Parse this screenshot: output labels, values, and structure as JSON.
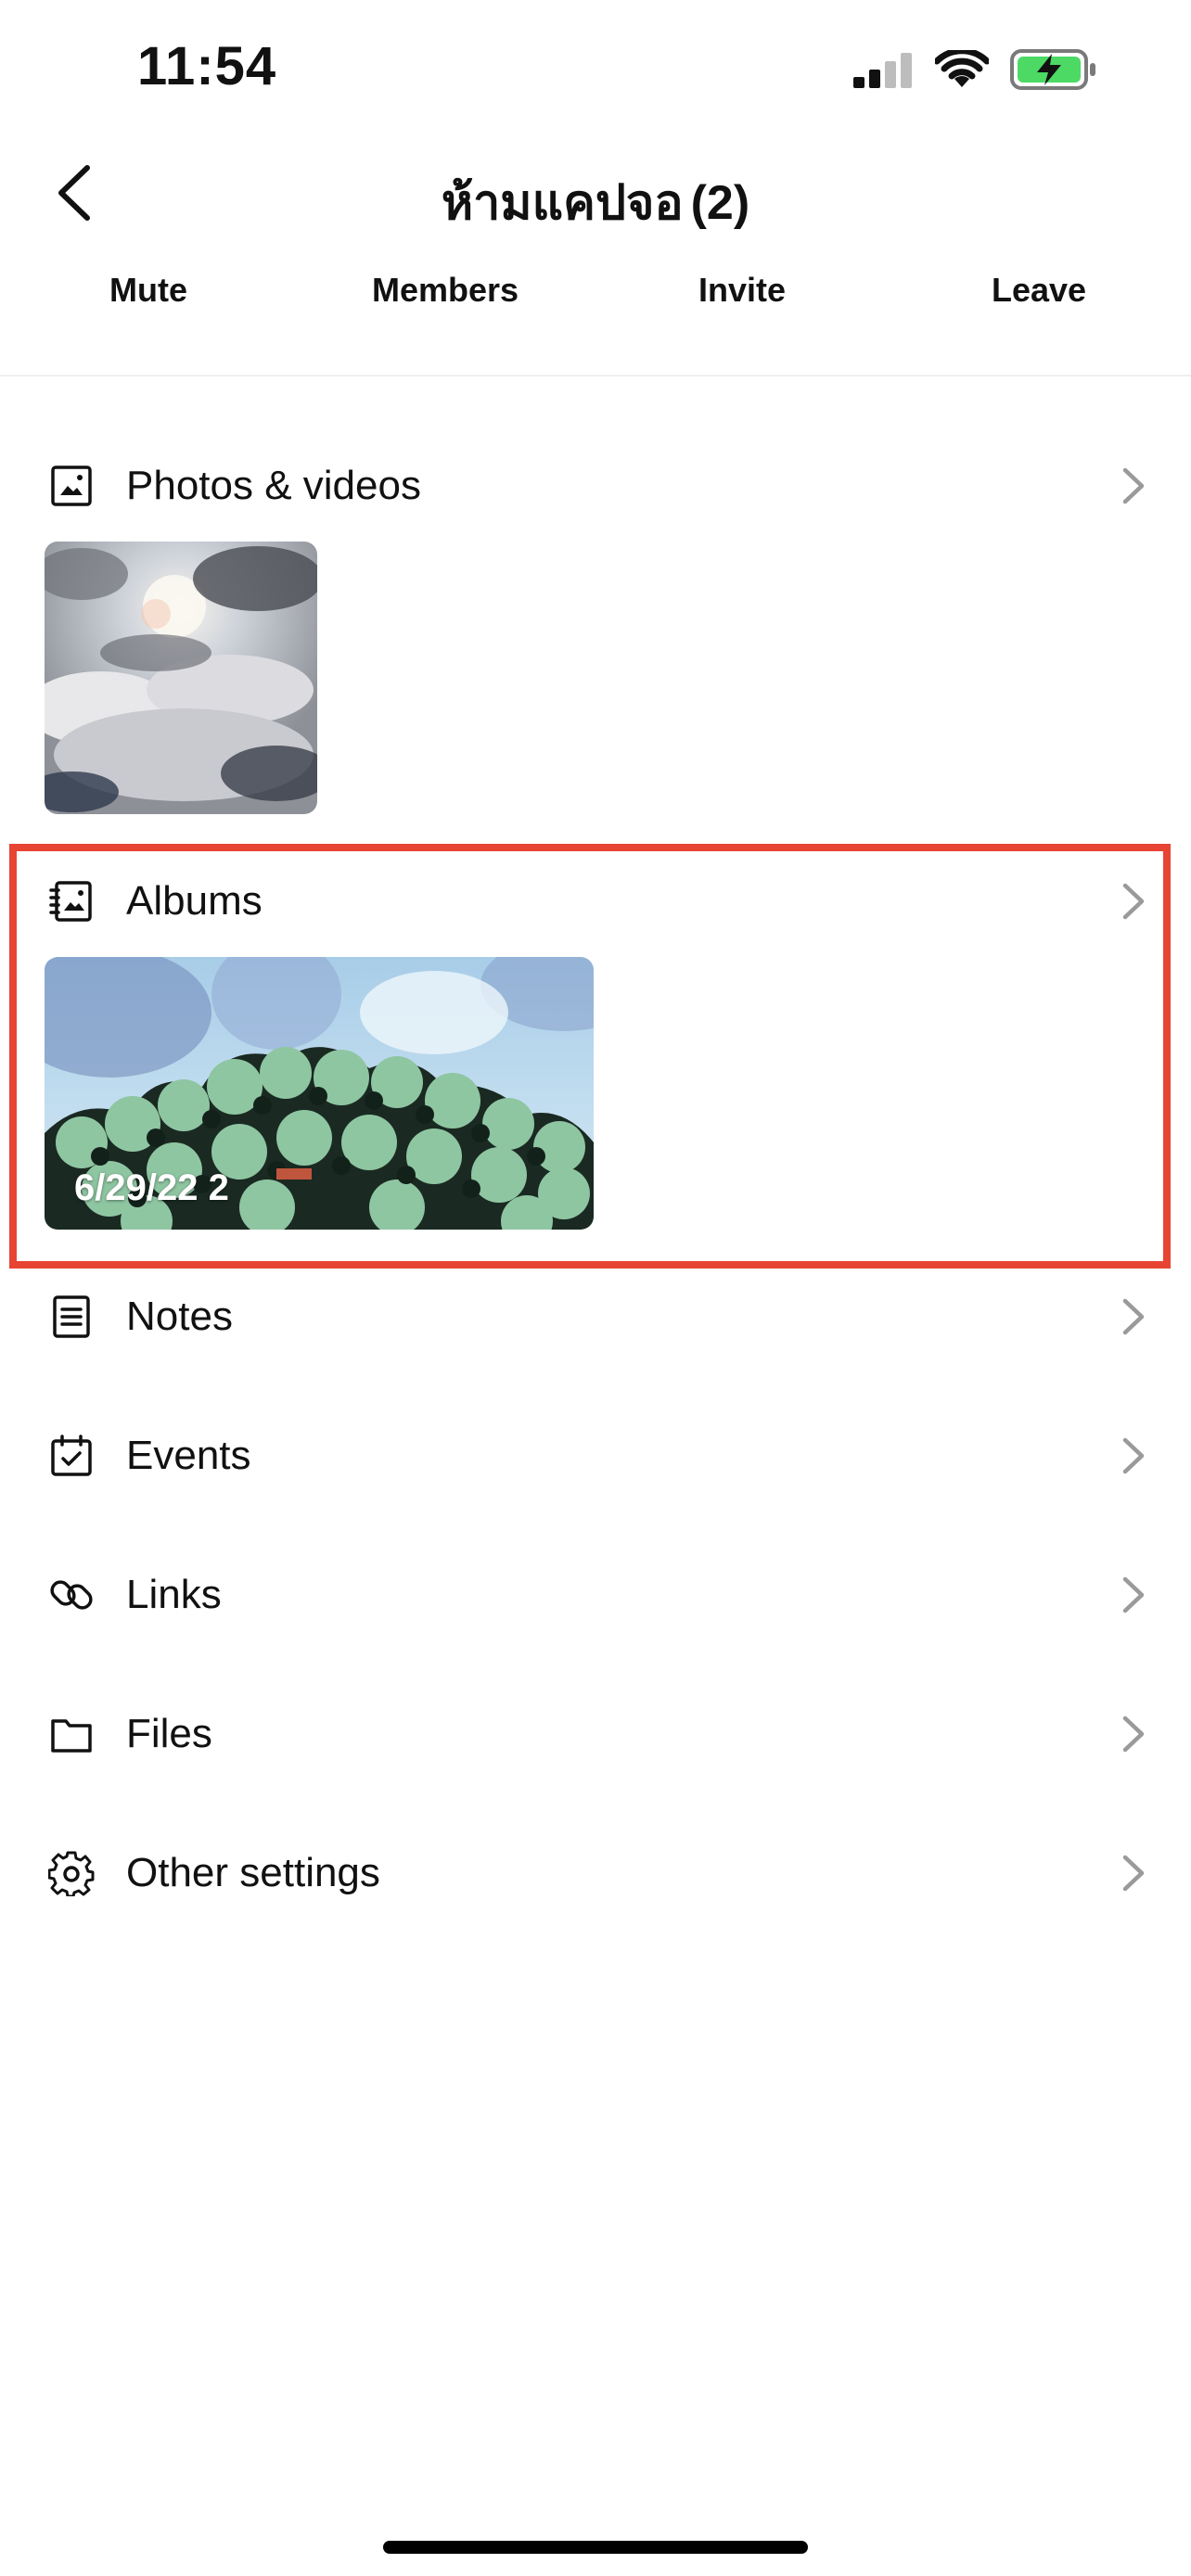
{
  "status_bar": {
    "time": "11:54",
    "icons": [
      "signal-icon",
      "wifi-icon",
      "battery-charging-icon"
    ],
    "battery_color": "#4cd964"
  },
  "header": {
    "title": "ห้ามแคปจอ",
    "count": "(2)",
    "back_icon": "chevron-left-icon"
  },
  "actions": {
    "mute": "Mute",
    "members": "Members",
    "invite": "Invite",
    "leave": "Leave"
  },
  "sections": {
    "photos": {
      "label": "Photos & videos",
      "icon": "photo-icon"
    },
    "albums": {
      "label": "Albums",
      "icon": "album-icon",
      "album_caption": "6/29/22 2"
    },
    "notes": {
      "label": "Notes",
      "icon": "note-icon"
    },
    "events": {
      "label": "Events",
      "icon": "calendar-check-icon"
    },
    "links": {
      "label": "Links",
      "icon": "link-icon"
    },
    "files": {
      "label": "Files",
      "icon": "folder-icon"
    },
    "settings": {
      "label": "Other settings",
      "icon": "gear-icon"
    }
  },
  "colors": {
    "highlight": "#e74433",
    "text": "#111111",
    "chevron": "#9a9a9a"
  }
}
